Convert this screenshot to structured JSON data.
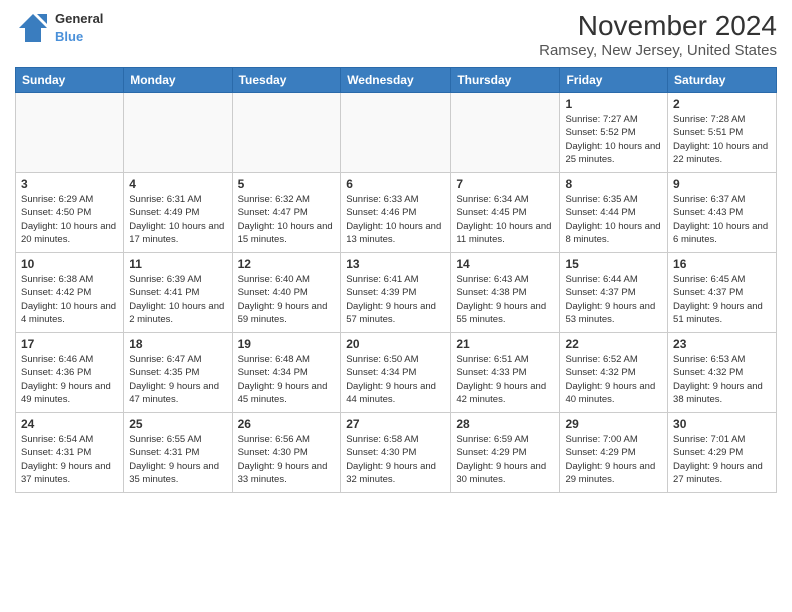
{
  "header": {
    "logo": {
      "general": "General",
      "blue": "Blue"
    },
    "title": "November 2024",
    "subtitle": "Ramsey, New Jersey, United States"
  },
  "weekdays": [
    "Sunday",
    "Monday",
    "Tuesday",
    "Wednesday",
    "Thursday",
    "Friday",
    "Saturday"
  ],
  "weeks": [
    [
      {
        "day": "",
        "info": "",
        "empty": true
      },
      {
        "day": "",
        "info": "",
        "empty": true
      },
      {
        "day": "",
        "info": "",
        "empty": true
      },
      {
        "day": "",
        "info": "",
        "empty": true
      },
      {
        "day": "",
        "info": "",
        "empty": true
      },
      {
        "day": "1",
        "info": "Sunrise: 7:27 AM\nSunset: 5:52 PM\nDaylight: 10 hours and 25 minutes.",
        "empty": false
      },
      {
        "day": "2",
        "info": "Sunrise: 7:28 AM\nSunset: 5:51 PM\nDaylight: 10 hours and 22 minutes.",
        "empty": false
      }
    ],
    [
      {
        "day": "3",
        "info": "Sunrise: 6:29 AM\nSunset: 4:50 PM\nDaylight: 10 hours and 20 minutes.",
        "empty": false
      },
      {
        "day": "4",
        "info": "Sunrise: 6:31 AM\nSunset: 4:49 PM\nDaylight: 10 hours and 17 minutes.",
        "empty": false
      },
      {
        "day": "5",
        "info": "Sunrise: 6:32 AM\nSunset: 4:47 PM\nDaylight: 10 hours and 15 minutes.",
        "empty": false
      },
      {
        "day": "6",
        "info": "Sunrise: 6:33 AM\nSunset: 4:46 PM\nDaylight: 10 hours and 13 minutes.",
        "empty": false
      },
      {
        "day": "7",
        "info": "Sunrise: 6:34 AM\nSunset: 4:45 PM\nDaylight: 10 hours and 11 minutes.",
        "empty": false
      },
      {
        "day": "8",
        "info": "Sunrise: 6:35 AM\nSunset: 4:44 PM\nDaylight: 10 hours and 8 minutes.",
        "empty": false
      },
      {
        "day": "9",
        "info": "Sunrise: 6:37 AM\nSunset: 4:43 PM\nDaylight: 10 hours and 6 minutes.",
        "empty": false
      }
    ],
    [
      {
        "day": "10",
        "info": "Sunrise: 6:38 AM\nSunset: 4:42 PM\nDaylight: 10 hours and 4 minutes.",
        "empty": false
      },
      {
        "day": "11",
        "info": "Sunrise: 6:39 AM\nSunset: 4:41 PM\nDaylight: 10 hours and 2 minutes.",
        "empty": false
      },
      {
        "day": "12",
        "info": "Sunrise: 6:40 AM\nSunset: 4:40 PM\nDaylight: 9 hours and 59 minutes.",
        "empty": false
      },
      {
        "day": "13",
        "info": "Sunrise: 6:41 AM\nSunset: 4:39 PM\nDaylight: 9 hours and 57 minutes.",
        "empty": false
      },
      {
        "day": "14",
        "info": "Sunrise: 6:43 AM\nSunset: 4:38 PM\nDaylight: 9 hours and 55 minutes.",
        "empty": false
      },
      {
        "day": "15",
        "info": "Sunrise: 6:44 AM\nSunset: 4:37 PM\nDaylight: 9 hours and 53 minutes.",
        "empty": false
      },
      {
        "day": "16",
        "info": "Sunrise: 6:45 AM\nSunset: 4:37 PM\nDaylight: 9 hours and 51 minutes.",
        "empty": false
      }
    ],
    [
      {
        "day": "17",
        "info": "Sunrise: 6:46 AM\nSunset: 4:36 PM\nDaylight: 9 hours and 49 minutes.",
        "empty": false
      },
      {
        "day": "18",
        "info": "Sunrise: 6:47 AM\nSunset: 4:35 PM\nDaylight: 9 hours and 47 minutes.",
        "empty": false
      },
      {
        "day": "19",
        "info": "Sunrise: 6:48 AM\nSunset: 4:34 PM\nDaylight: 9 hours and 45 minutes.",
        "empty": false
      },
      {
        "day": "20",
        "info": "Sunrise: 6:50 AM\nSunset: 4:34 PM\nDaylight: 9 hours and 44 minutes.",
        "empty": false
      },
      {
        "day": "21",
        "info": "Sunrise: 6:51 AM\nSunset: 4:33 PM\nDaylight: 9 hours and 42 minutes.",
        "empty": false
      },
      {
        "day": "22",
        "info": "Sunrise: 6:52 AM\nSunset: 4:32 PM\nDaylight: 9 hours and 40 minutes.",
        "empty": false
      },
      {
        "day": "23",
        "info": "Sunrise: 6:53 AM\nSunset: 4:32 PM\nDaylight: 9 hours and 38 minutes.",
        "empty": false
      }
    ],
    [
      {
        "day": "24",
        "info": "Sunrise: 6:54 AM\nSunset: 4:31 PM\nDaylight: 9 hours and 37 minutes.",
        "empty": false
      },
      {
        "day": "25",
        "info": "Sunrise: 6:55 AM\nSunset: 4:31 PM\nDaylight: 9 hours and 35 minutes.",
        "empty": false
      },
      {
        "day": "26",
        "info": "Sunrise: 6:56 AM\nSunset: 4:30 PM\nDaylight: 9 hours and 33 minutes.",
        "empty": false
      },
      {
        "day": "27",
        "info": "Sunrise: 6:58 AM\nSunset: 4:30 PM\nDaylight: 9 hours and 32 minutes.",
        "empty": false
      },
      {
        "day": "28",
        "info": "Sunrise: 6:59 AM\nSunset: 4:29 PM\nDaylight: 9 hours and 30 minutes.",
        "empty": false
      },
      {
        "day": "29",
        "info": "Sunrise: 7:00 AM\nSunset: 4:29 PM\nDaylight: 9 hours and 29 minutes.",
        "empty": false
      },
      {
        "day": "30",
        "info": "Sunrise: 7:01 AM\nSunset: 4:29 PM\nDaylight: 9 hours and 27 minutes.",
        "empty": false
      }
    ]
  ]
}
